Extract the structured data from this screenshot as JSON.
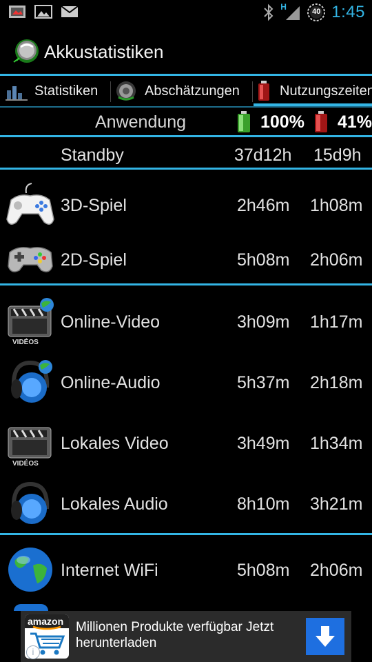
{
  "status_bar": {
    "notification_icons": [
      "photo-icon",
      "gallery-icon",
      "mail-icon"
    ],
    "system_icons": [
      "bluetooth-icon",
      "signal-h-icon",
      "battery-40-icon"
    ],
    "battery_level": "40",
    "network_type": "H",
    "time": "1:45"
  },
  "app_bar": {
    "title": "Akkustatistiken",
    "icon": "battery-app-icon"
  },
  "tabs": [
    {
      "label": "Statistiken",
      "icon": "chart-icon"
    },
    {
      "label": "Abschätzungen",
      "icon": "battery-disc-icon"
    },
    {
      "label": "Nutzungszeiten",
      "icon": "red-battery-icon",
      "selected": true
    }
  ],
  "table": {
    "column_header": "Anwendung",
    "full_percent": "100%",
    "current_percent": "41%",
    "standby": {
      "label": "Standby",
      "full": "37d12h",
      "current": "15d9h"
    },
    "groups": [
      [
        {
          "label": "3D-Spiel",
          "icon": "gamepad-3d-icon",
          "full": "2h46m",
          "current": "1h08m"
        },
        {
          "label": "2D-Spiel",
          "icon": "gamepad-2d-icon",
          "full": "5h08m",
          "current": "2h06m"
        }
      ],
      [
        {
          "label": "Online-Video",
          "icon": "online-video-icon",
          "full": "3h09m",
          "current": "1h17m",
          "icon_caption": "VIDÉOS"
        },
        {
          "label": "Online-Audio",
          "icon": "online-audio-icon",
          "full": "5h37m",
          "current": "2h18m"
        },
        {
          "label": "Lokales Video",
          "icon": "local-video-icon",
          "full": "3h49m",
          "current": "1h34m",
          "icon_caption": "VIDÉOS"
        },
        {
          "label": "Lokales Audio",
          "icon": "local-audio-icon",
          "full": "8h10m",
          "current": "3h21m"
        }
      ],
      [
        {
          "label": "Internet WiFi",
          "icon": "globe-icon",
          "full": "5h08m",
          "current": "2h06m"
        }
      ]
    ]
  },
  "ad": {
    "brand": "amazon",
    "text": "Millionen Produkte verfügbar Jetzt herunterladen",
    "icons": [
      "amazon-cart-icon",
      "download-icon",
      "info-icon"
    ]
  },
  "colors": {
    "accent": "#33b5e5",
    "background": "#000000",
    "ad_background": "#2b2b2b",
    "download_button": "#1e6fe0"
  }
}
